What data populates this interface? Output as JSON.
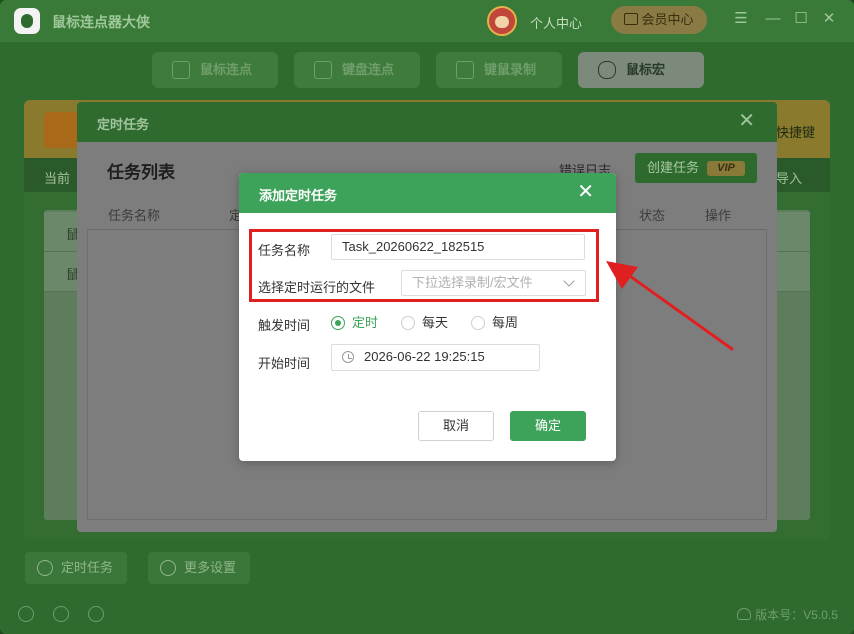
{
  "app": {
    "title": "鼠标连点器大侠",
    "personal_center": "个人中心",
    "vip_center": "会员中心",
    "window_controls": [
      "menu-icon",
      "minimize-icon",
      "maximize-icon",
      "close-icon"
    ]
  },
  "top_tabs": [
    {
      "label": "鼠标连点",
      "icon": "cursor-icon",
      "active": false
    },
    {
      "label": "键盘连点",
      "icon": "keyboard-icon",
      "active": false
    },
    {
      "label": "键鼠录制",
      "icon": "video-icon",
      "active": false
    },
    {
      "label": "鼠标宏",
      "icon": "mouse-icon",
      "active": true
    }
  ],
  "background": {
    "shortcut_label": "快捷键",
    "current_prefix": "当前",
    "import_label": "导入",
    "row_text_1": "鼠",
    "row_text_2": "鼠"
  },
  "bottom_bar": {
    "scheduled_tasks": "定时任务",
    "more_settings": "更多设置",
    "version": "版本号：V5.0.5"
  },
  "task_dialog": {
    "title": "定时任务",
    "list_title": "任务列表",
    "error_log": "错误日志",
    "create_task": "创建任务",
    "vip_tag": "VIP",
    "columns": [
      "任务名称",
      "定",
      "状态",
      "操作"
    ]
  },
  "add_dialog": {
    "title": "添加定时任务",
    "task_name_label": "任务名称",
    "task_name_value": "Task_20260622_182515",
    "file_label": "选择定时运行的文件",
    "file_placeholder": "下拉选择录制/宏文件",
    "trigger_label": "触发时间",
    "trigger_options": [
      {
        "label": "定时",
        "selected": true
      },
      {
        "label": "每天",
        "selected": false
      },
      {
        "label": "每周",
        "selected": false
      }
    ],
    "start_label": "开始时间",
    "start_value": "2026-06-22 19:25:15",
    "cancel": "取消",
    "confirm": "确定"
  },
  "colors": {
    "accent_green": "#3da35a",
    "annotation_red": "#e02020"
  }
}
